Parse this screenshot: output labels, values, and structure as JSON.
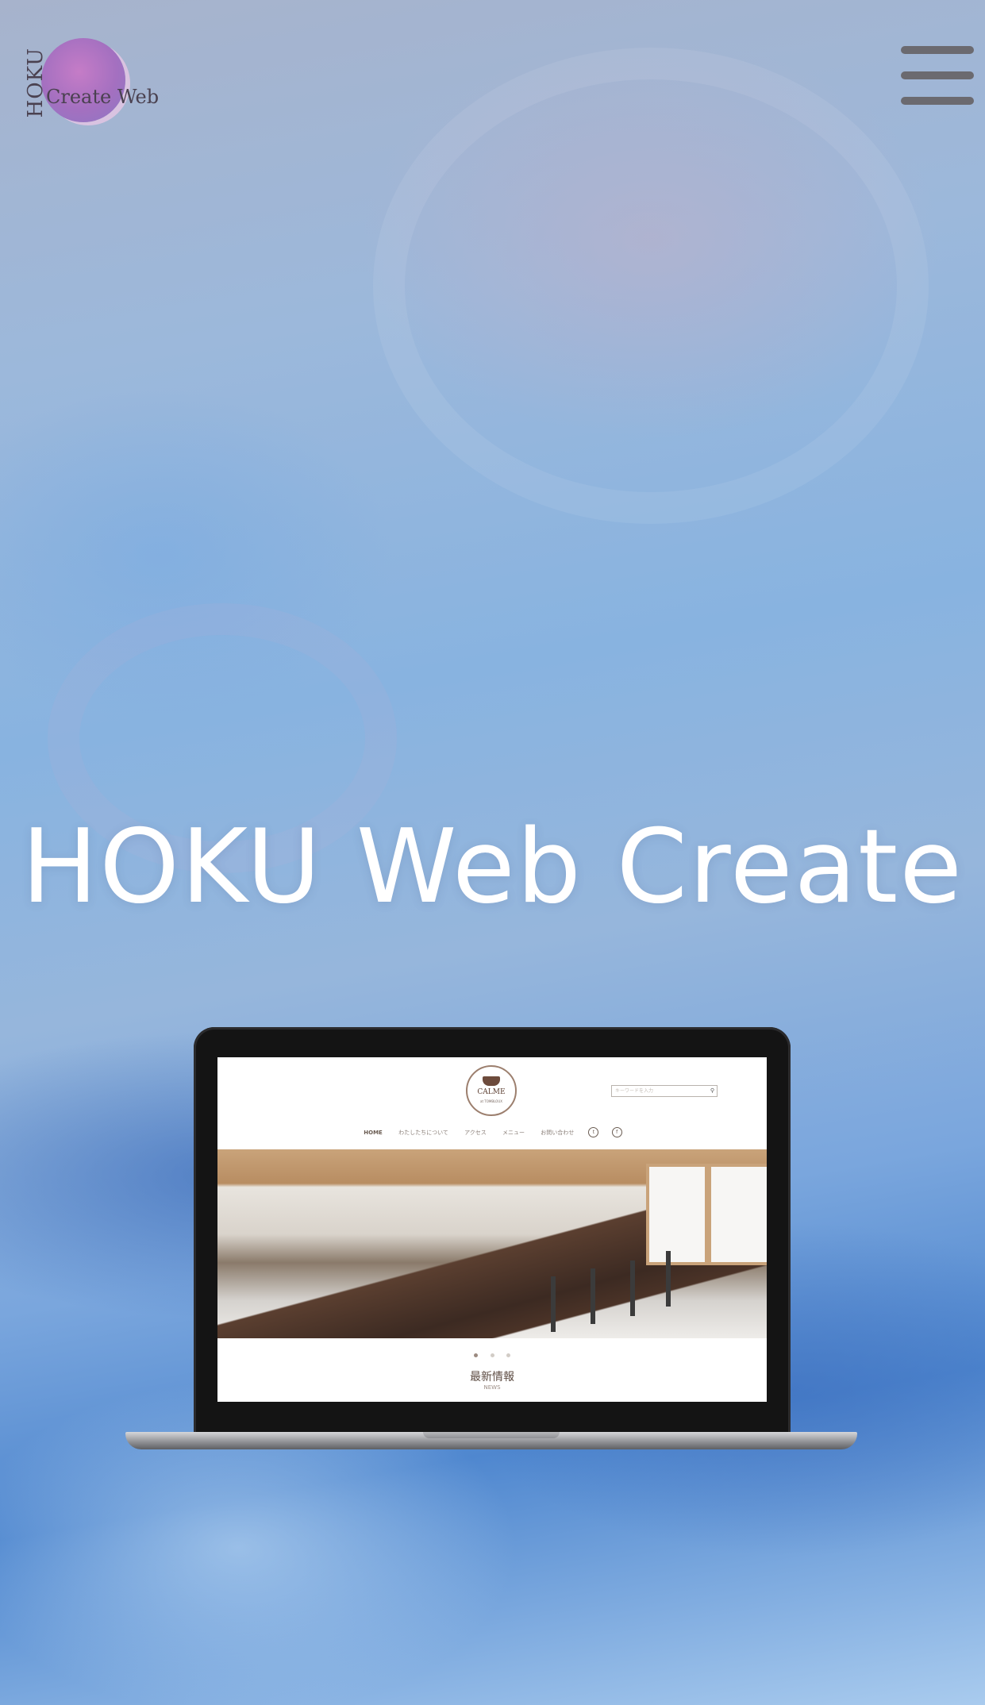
{
  "header": {
    "logo": {
      "vertical_text": "HOKU",
      "horizontal_text": "Create Web"
    },
    "menu_icon": "hamburger-menu-icon"
  },
  "hero": {
    "title": "HOKU Web Create"
  },
  "laptop_preview": {
    "site_logo": {
      "name": "CALME",
      "sub": "at TOMBLOUX"
    },
    "search_placeholder": "キーワードを入力",
    "search_icon": "magnifier-icon",
    "nav": {
      "items": [
        "HOME",
        "わたしたちについて",
        "アクセス",
        "メニュー",
        "お問い合わせ"
      ],
      "social": [
        "t",
        "f"
      ]
    },
    "slider_dots": 3,
    "news_title": "最新情報",
    "news_sub": "NEWS"
  }
}
